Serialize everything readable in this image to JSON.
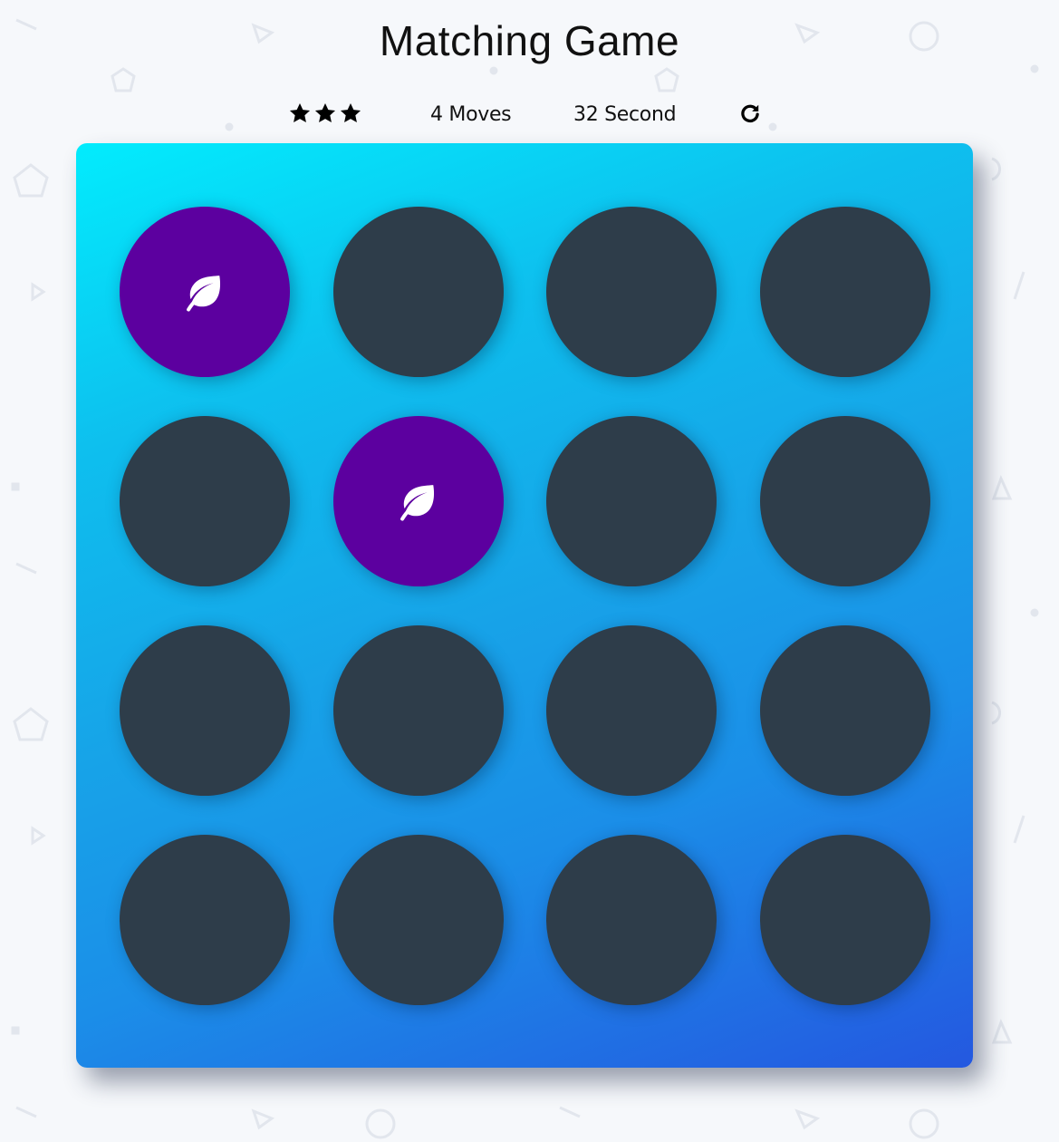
{
  "game": {
    "title": "Matching Game"
  },
  "score_panel": {
    "stars": 3,
    "moves_label": "4 Moves",
    "timer_label": "32 Second",
    "restart_icon": "restart-icon"
  },
  "deck": {
    "rows": 4,
    "columns": 4,
    "cards": [
      {
        "state": "open",
        "icon": "leaf-icon"
      },
      {
        "state": "closed",
        "icon": ""
      },
      {
        "state": "closed",
        "icon": ""
      },
      {
        "state": "closed",
        "icon": ""
      },
      {
        "state": "closed",
        "icon": ""
      },
      {
        "state": "open",
        "icon": "leaf-icon"
      },
      {
        "state": "closed",
        "icon": ""
      },
      {
        "state": "closed",
        "icon": ""
      },
      {
        "state": "closed",
        "icon": ""
      },
      {
        "state": "closed",
        "icon": ""
      },
      {
        "state": "closed",
        "icon": ""
      },
      {
        "state": "closed",
        "icon": ""
      },
      {
        "state": "closed",
        "icon": ""
      },
      {
        "state": "closed",
        "icon": ""
      },
      {
        "state": "closed",
        "icon": ""
      },
      {
        "state": "closed",
        "icon": ""
      }
    ]
  },
  "colors": {
    "card_closed": "#2e3d4a",
    "card_open": "#5c009f",
    "deck_gradient_start": "#02ecfd",
    "deck_gradient_end": "#2458e0"
  }
}
